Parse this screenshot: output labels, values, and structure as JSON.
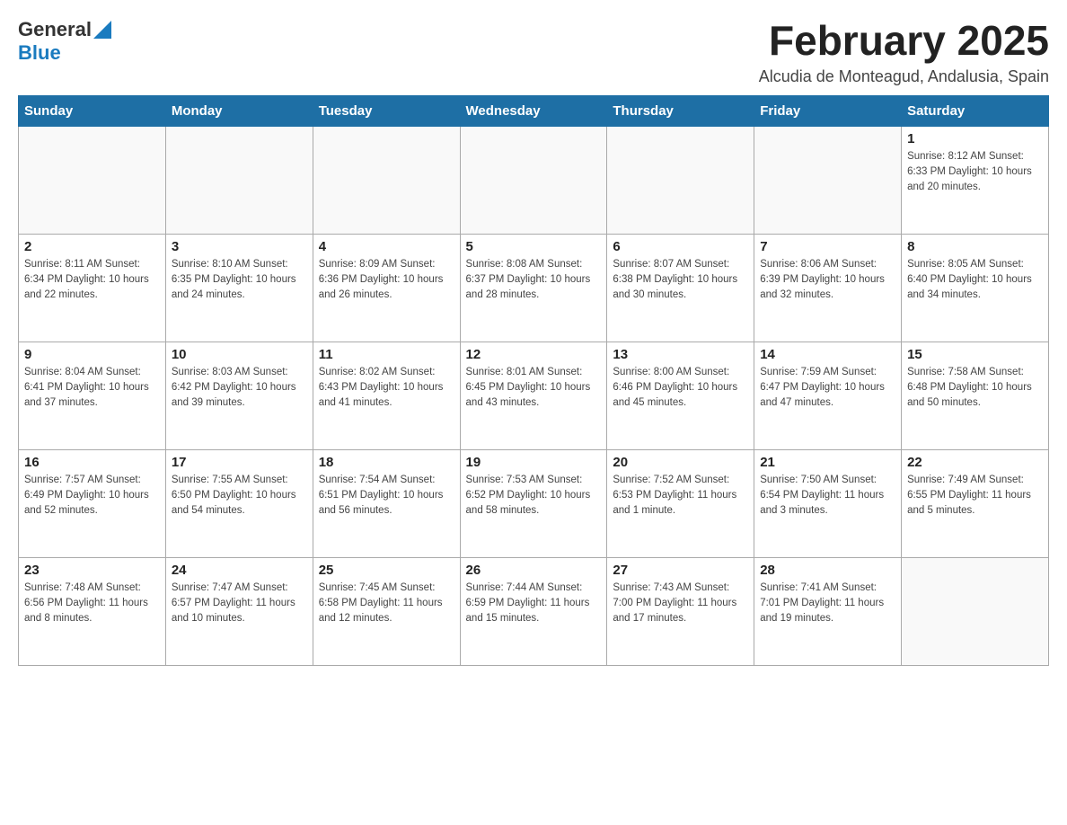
{
  "header": {
    "logo_general": "General",
    "logo_blue": "Blue",
    "month_title": "February 2025",
    "location": "Alcudia de Monteagud, Andalusia, Spain"
  },
  "weekdays": [
    "Sunday",
    "Monday",
    "Tuesday",
    "Wednesday",
    "Thursday",
    "Friday",
    "Saturday"
  ],
  "weeks": [
    [
      {
        "day": "",
        "info": ""
      },
      {
        "day": "",
        "info": ""
      },
      {
        "day": "",
        "info": ""
      },
      {
        "day": "",
        "info": ""
      },
      {
        "day": "",
        "info": ""
      },
      {
        "day": "",
        "info": ""
      },
      {
        "day": "1",
        "info": "Sunrise: 8:12 AM\nSunset: 6:33 PM\nDaylight: 10 hours and 20 minutes."
      }
    ],
    [
      {
        "day": "2",
        "info": "Sunrise: 8:11 AM\nSunset: 6:34 PM\nDaylight: 10 hours and 22 minutes."
      },
      {
        "day": "3",
        "info": "Sunrise: 8:10 AM\nSunset: 6:35 PM\nDaylight: 10 hours and 24 minutes."
      },
      {
        "day": "4",
        "info": "Sunrise: 8:09 AM\nSunset: 6:36 PM\nDaylight: 10 hours and 26 minutes."
      },
      {
        "day": "5",
        "info": "Sunrise: 8:08 AM\nSunset: 6:37 PM\nDaylight: 10 hours and 28 minutes."
      },
      {
        "day": "6",
        "info": "Sunrise: 8:07 AM\nSunset: 6:38 PM\nDaylight: 10 hours and 30 minutes."
      },
      {
        "day": "7",
        "info": "Sunrise: 8:06 AM\nSunset: 6:39 PM\nDaylight: 10 hours and 32 minutes."
      },
      {
        "day": "8",
        "info": "Sunrise: 8:05 AM\nSunset: 6:40 PM\nDaylight: 10 hours and 34 minutes."
      }
    ],
    [
      {
        "day": "9",
        "info": "Sunrise: 8:04 AM\nSunset: 6:41 PM\nDaylight: 10 hours and 37 minutes."
      },
      {
        "day": "10",
        "info": "Sunrise: 8:03 AM\nSunset: 6:42 PM\nDaylight: 10 hours and 39 minutes."
      },
      {
        "day": "11",
        "info": "Sunrise: 8:02 AM\nSunset: 6:43 PM\nDaylight: 10 hours and 41 minutes."
      },
      {
        "day": "12",
        "info": "Sunrise: 8:01 AM\nSunset: 6:45 PM\nDaylight: 10 hours and 43 minutes."
      },
      {
        "day": "13",
        "info": "Sunrise: 8:00 AM\nSunset: 6:46 PM\nDaylight: 10 hours and 45 minutes."
      },
      {
        "day": "14",
        "info": "Sunrise: 7:59 AM\nSunset: 6:47 PM\nDaylight: 10 hours and 47 minutes."
      },
      {
        "day": "15",
        "info": "Sunrise: 7:58 AM\nSunset: 6:48 PM\nDaylight: 10 hours and 50 minutes."
      }
    ],
    [
      {
        "day": "16",
        "info": "Sunrise: 7:57 AM\nSunset: 6:49 PM\nDaylight: 10 hours and 52 minutes."
      },
      {
        "day": "17",
        "info": "Sunrise: 7:55 AM\nSunset: 6:50 PM\nDaylight: 10 hours and 54 minutes."
      },
      {
        "day": "18",
        "info": "Sunrise: 7:54 AM\nSunset: 6:51 PM\nDaylight: 10 hours and 56 minutes."
      },
      {
        "day": "19",
        "info": "Sunrise: 7:53 AM\nSunset: 6:52 PM\nDaylight: 10 hours and 58 minutes."
      },
      {
        "day": "20",
        "info": "Sunrise: 7:52 AM\nSunset: 6:53 PM\nDaylight: 11 hours and 1 minute."
      },
      {
        "day": "21",
        "info": "Sunrise: 7:50 AM\nSunset: 6:54 PM\nDaylight: 11 hours and 3 minutes."
      },
      {
        "day": "22",
        "info": "Sunrise: 7:49 AM\nSunset: 6:55 PM\nDaylight: 11 hours and 5 minutes."
      }
    ],
    [
      {
        "day": "23",
        "info": "Sunrise: 7:48 AM\nSunset: 6:56 PM\nDaylight: 11 hours and 8 minutes."
      },
      {
        "day": "24",
        "info": "Sunrise: 7:47 AM\nSunset: 6:57 PM\nDaylight: 11 hours and 10 minutes."
      },
      {
        "day": "25",
        "info": "Sunrise: 7:45 AM\nSunset: 6:58 PM\nDaylight: 11 hours and 12 minutes."
      },
      {
        "day": "26",
        "info": "Sunrise: 7:44 AM\nSunset: 6:59 PM\nDaylight: 11 hours and 15 minutes."
      },
      {
        "day": "27",
        "info": "Sunrise: 7:43 AM\nSunset: 7:00 PM\nDaylight: 11 hours and 17 minutes."
      },
      {
        "day": "28",
        "info": "Sunrise: 7:41 AM\nSunset: 7:01 PM\nDaylight: 11 hours and 19 minutes."
      },
      {
        "day": "",
        "info": ""
      }
    ]
  ]
}
